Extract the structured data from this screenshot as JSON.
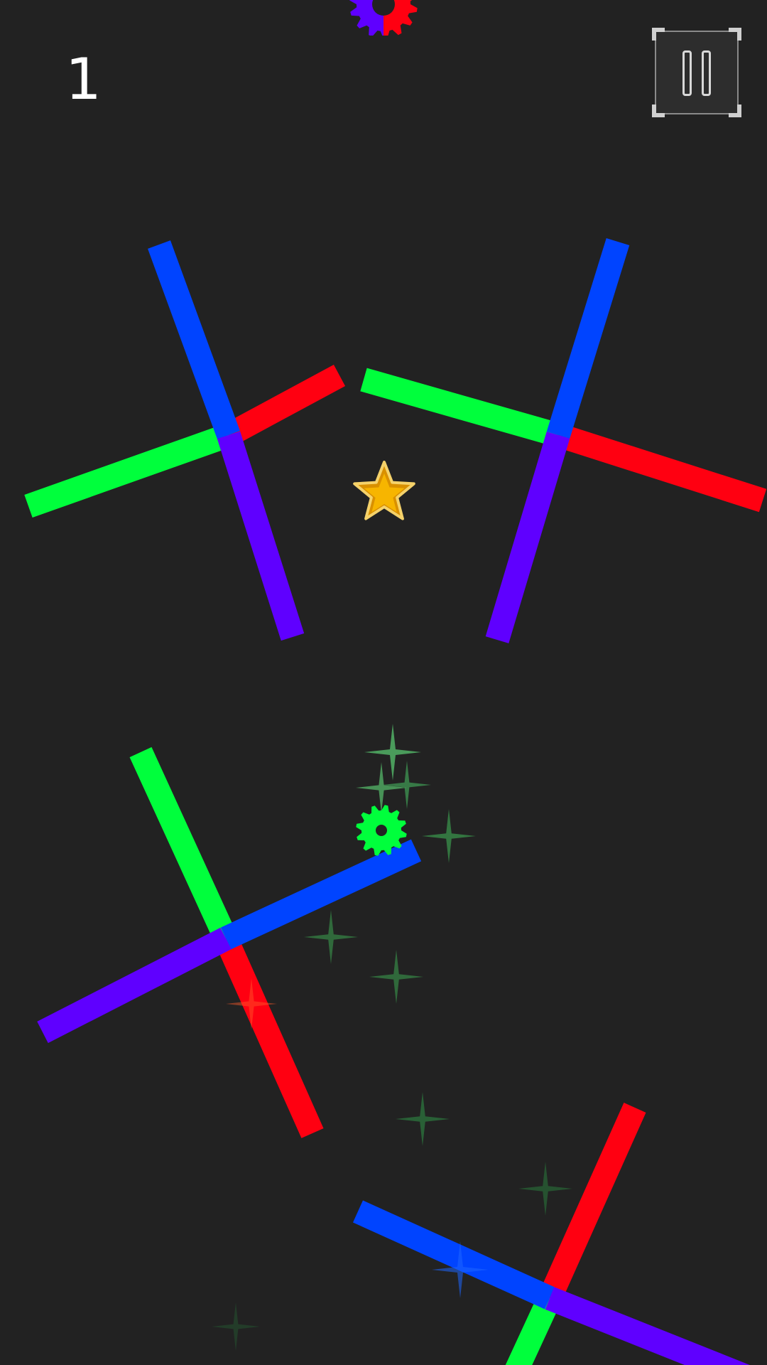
{
  "hud": {
    "score": "1",
    "pause_icon": "pause-icon"
  },
  "colors": {
    "background": "#222222",
    "red": "#ff0011",
    "green": "#00ff3c",
    "blue": "#0044ff",
    "purple": "#5f00ff",
    "star_gold": "#f7b500",
    "sparkle": "#2d8a3e"
  },
  "player": {
    "shape": "gear",
    "color": "green"
  },
  "obstacles": {
    "type": "four-arm spinner",
    "arm_colors": [
      "red",
      "green",
      "blue",
      "purple"
    ]
  },
  "pickups": [
    "star",
    "color-switch-gear"
  ]
}
